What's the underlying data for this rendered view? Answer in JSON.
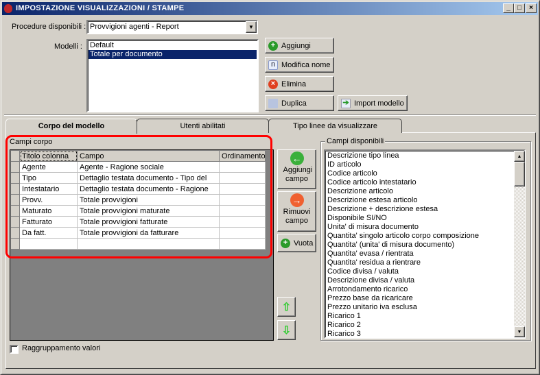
{
  "window": {
    "title": "IMPOSTAZIONE VISUALIZZAZIONI / STAMPE",
    "minimize": "_",
    "maximize": "□",
    "close": "×"
  },
  "procedure": {
    "label": "Procedure disponibili :",
    "value": "Provvigioni agenti - Report"
  },
  "modelli": {
    "label": "Modelli :",
    "items": [
      "Default",
      "Totale per documento"
    ],
    "selected": "Totale per documento"
  },
  "buttons": {
    "aggiungi": "Aggiungi",
    "modifica": "Modifica nome",
    "elimina": "Elimina",
    "duplica": "Duplica",
    "import": "Import modello"
  },
  "tabs": [
    "Corpo del modello",
    "Utenti abilitati",
    "Tipo linee da visualizzare"
  ],
  "campi_corpo": {
    "label": "Campi corpo",
    "headers": [
      "Titolo colonna",
      "Campo",
      "Ordinamento"
    ],
    "rows": [
      [
        "Agente",
        "Agente - Ragione sociale",
        ""
      ],
      [
        "Tipo",
        "Dettaglio testata documento - Tipo del",
        ""
      ],
      [
        "Intestatario",
        "Dettaglio testata documento - Ragione",
        ""
      ],
      [
        "Provv.",
        "Totale provvigioni",
        ""
      ],
      [
        "Maturato",
        "Totale provvigioni maturate",
        ""
      ],
      [
        "Fatturato",
        "Totale provvigioni fatturate",
        ""
      ],
      [
        "Da fatt.",
        "Totale provvigioni da fatturare",
        ""
      ],
      [
        "",
        "",
        ""
      ]
    ]
  },
  "side_buttons": {
    "aggiungi_campo": "Aggiungi campo",
    "rimuovi_campo": "Rimuovi campo",
    "vuota": "Vuota"
  },
  "raggruppamento": {
    "label": "Raggruppamento valori",
    "checked": false
  },
  "campi_disponibili": {
    "label": "Campi disponibili",
    "items": [
      "Descrizione tipo linea",
      "ID articolo",
      "Codice articolo",
      "Codice articolo intestatario",
      "Descrizione articolo",
      "Descrizione estesa articolo",
      "Descrizione + descrizione estesa",
      "Disponibile SI/NO",
      "Unita' di misura documento",
      "Quantita' singolo articolo corpo composizione",
      "Quantita' (unita' di misura documento)",
      "Quantita' evasa / rientrata",
      "Quantita' residua a rientrare",
      "Codice divisa / valuta",
      "Descrizione divisa / valuta",
      "Arrotondamento ricarico",
      "Prezzo base da ricaricare",
      "Prezzo unitario iva esclusa",
      "Ricarico 1",
      "Ricarico 2",
      "Ricarico 3"
    ]
  }
}
